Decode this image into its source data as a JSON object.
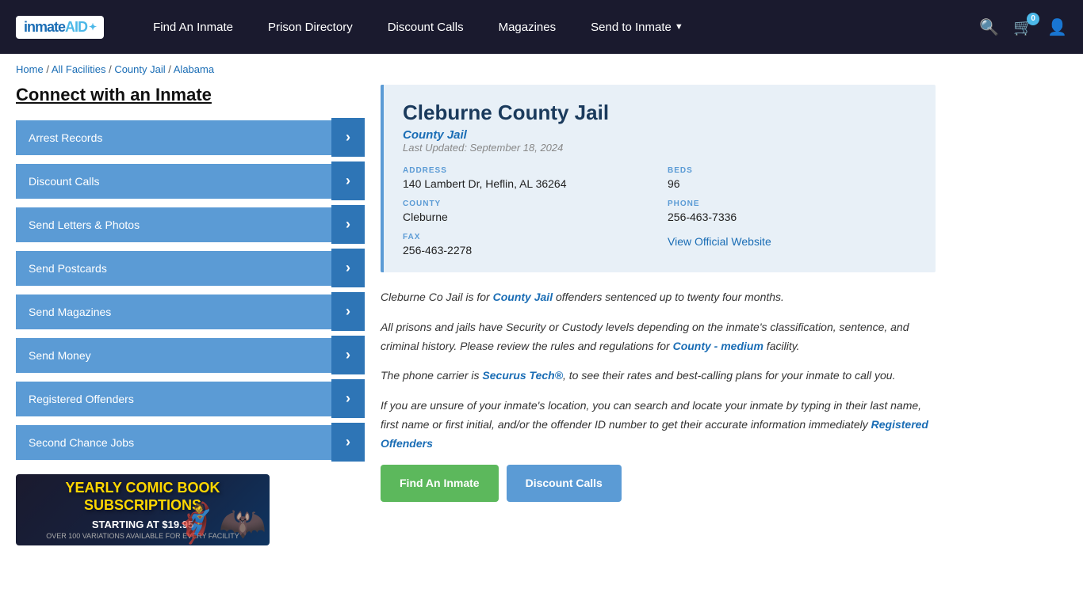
{
  "nav": {
    "logo_text": "inmate",
    "logo_aid": "AID",
    "links": [
      {
        "label": "Find An Inmate",
        "id": "find-inmate",
        "dropdown": false
      },
      {
        "label": "Prison Directory",
        "id": "prison-directory",
        "dropdown": false
      },
      {
        "label": "Discount Calls",
        "id": "discount-calls",
        "dropdown": false
      },
      {
        "label": "Magazines",
        "id": "magazines",
        "dropdown": false
      },
      {
        "label": "Send to Inmate",
        "id": "send-to-inmate",
        "dropdown": true
      }
    ],
    "cart_count": "0",
    "search_icon": "🔍",
    "cart_icon": "🛒",
    "user_icon": "👤"
  },
  "breadcrumb": {
    "items": [
      {
        "label": "Home",
        "href": "#"
      },
      {
        "label": "All Facilities",
        "href": "#"
      },
      {
        "label": "County Jail",
        "href": "#"
      },
      {
        "label": "Alabama",
        "href": "#"
      }
    ],
    "separator": "/"
  },
  "sidebar": {
    "title": "Connect with an Inmate",
    "items": [
      {
        "label": "Arrest Records",
        "id": "arrest-records"
      },
      {
        "label": "Discount Calls",
        "id": "discount-calls"
      },
      {
        "label": "Send Letters & Photos",
        "id": "send-letters"
      },
      {
        "label": "Send Postcards",
        "id": "send-postcards"
      },
      {
        "label": "Send Magazines",
        "id": "send-magazines"
      },
      {
        "label": "Send Money",
        "id": "send-money"
      },
      {
        "label": "Registered Offenders",
        "id": "registered-offenders"
      },
      {
        "label": "Second Chance Jobs",
        "id": "second-chance-jobs"
      }
    ],
    "ad": {
      "title": "YEARLY COMIC BOOK\nSUBSCRIPTIONS",
      "price_label": "STARTING AT $19.95",
      "note": "OVER 100 VARIATIONS AVAILABLE FOR EVERY FACILITY",
      "hero1": "🦸",
      "hero2": "🦇"
    }
  },
  "facility": {
    "name": "Cleburne County Jail",
    "type": "County Jail",
    "last_updated": "Last Updated: September 18, 2024",
    "address_label": "ADDRESS",
    "address": "140 Lambert Dr, Heflin, AL 36264",
    "beds_label": "BEDS",
    "beds": "96",
    "county_label": "COUNTY",
    "county": "Cleburne",
    "phone_label": "PHONE",
    "phone": "256-463-7336",
    "fax_label": "FAX",
    "fax": "256-463-2278",
    "website_label": "View Official Website",
    "website_href": "#"
  },
  "description": {
    "para1_before": "Cleburne Co Jail is for ",
    "para1_link": "County Jail",
    "para1_after": " offenders sentenced up to twenty four months.",
    "para2": "All prisons and jails have Security or Custody levels depending on the inmate's classification, sentence, and criminal history. Please review the rules and regulations for ",
    "para2_link": "County - medium",
    "para2_after": " facility.",
    "para3_before": "The phone carrier is ",
    "para3_link": "Securus Tech®",
    "para3_after": ", to see their rates and best-calling plans for your inmate to call you.",
    "para4": "If you are unsure of your inmate's location, you can search and locate your inmate by typing in their last name, first name or first initial, and/or the offender ID number to get their accurate information immediately ",
    "para4_link": "Registered Offenders",
    "buttons": [
      {
        "label": "Find An Inmate",
        "type": "green",
        "id": "find-inmate-btn"
      },
      {
        "label": "Discount Calls",
        "type": "blue",
        "id": "discount-calls-btn"
      }
    ]
  }
}
